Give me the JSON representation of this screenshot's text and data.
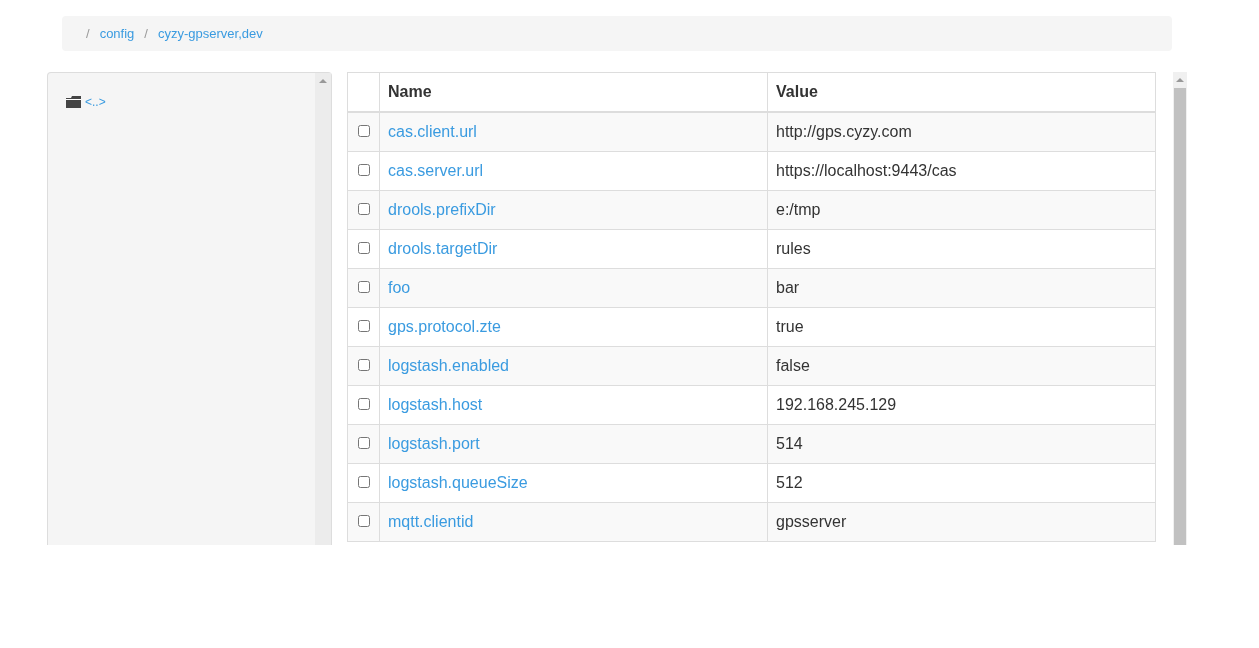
{
  "breadcrumb": {
    "separator": "/",
    "items": [
      {
        "label": "config"
      },
      {
        "label": "cyzy-gpserver,dev"
      }
    ]
  },
  "sidebar": {
    "items": [
      {
        "label": "<..>"
      }
    ]
  },
  "table": {
    "columns": [
      "Name",
      "Value"
    ],
    "rows": [
      {
        "name": "cas.client.url",
        "value": "http://gps.cyzy.com",
        "checked": false
      },
      {
        "name": "cas.server.url",
        "value": "https://localhost:9443/cas",
        "checked": false
      },
      {
        "name": "drools.prefixDir",
        "value": "e:/tmp",
        "checked": false
      },
      {
        "name": "drools.targetDir",
        "value": "rules",
        "checked": false
      },
      {
        "name": "foo",
        "value": "bar",
        "checked": false
      },
      {
        "name": "gps.protocol.zte",
        "value": "true",
        "checked": false
      },
      {
        "name": "logstash.enabled",
        "value": "false",
        "checked": false
      },
      {
        "name": "logstash.host",
        "value": "192.168.245.129",
        "checked": false
      },
      {
        "name": "logstash.port",
        "value": "514",
        "checked": false
      },
      {
        "name": "logstash.queueSize",
        "value": "512",
        "checked": false
      },
      {
        "name": "mqtt.clientid",
        "value": "gpsserver",
        "checked": false
      }
    ]
  }
}
